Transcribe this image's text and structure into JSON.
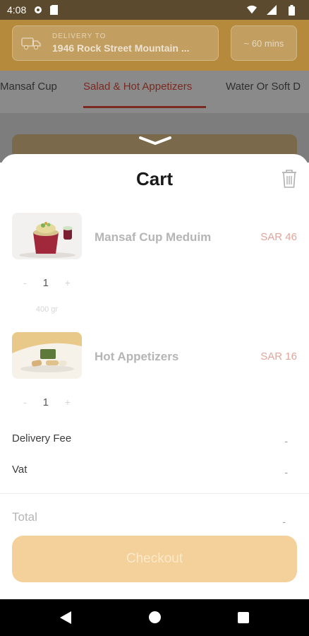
{
  "status_bar": {
    "time": "4:08"
  },
  "header": {
    "delivery_label": "DELIVERY TO",
    "delivery_address": "1946 Rock Street Mountain ...",
    "eta": "~ 60 mins"
  },
  "tabs": [
    {
      "label": "Mansaf Cup"
    },
    {
      "label": "Salad & Hot Appetizers",
      "active": true
    },
    {
      "label": "Water Or Soft D"
    }
  ],
  "cart": {
    "title": "Cart",
    "items": [
      {
        "name": "Mansaf Cup Meduim",
        "price": "SAR 46",
        "qty": "1",
        "weight": "400 gr"
      },
      {
        "name": "Hot Appetizers",
        "price": "SAR 16",
        "qty": "1"
      }
    ],
    "minus_symbol": "-",
    "plus_symbol": "+",
    "delivery_fee_label": "Delivery Fee",
    "delivery_fee_value": "-",
    "vat_label": "Vat",
    "vat_value": "-",
    "total_label": "Total",
    "total_value": "-",
    "checkout_label": "Checkout"
  },
  "colors": {
    "brand_header": "#b58a3d",
    "active_tab": "#7a2a20",
    "price": "#e2a59a",
    "checkout_bg": "#f4d09a"
  }
}
